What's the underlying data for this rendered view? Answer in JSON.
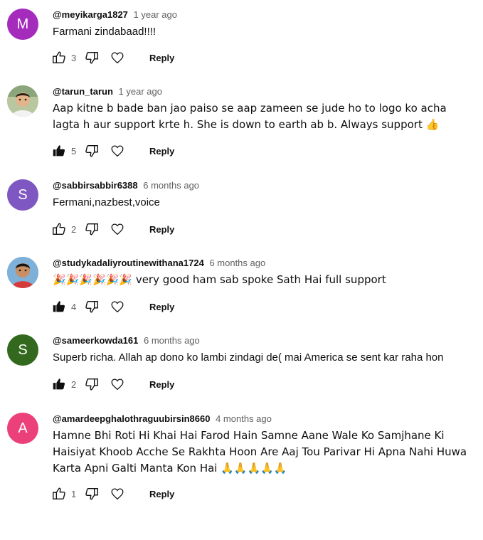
{
  "comments": [
    {
      "author": "@meyikarga1827",
      "time": "1 year ago",
      "text": "Farmani zindabaad!!!!",
      "likes": "3",
      "liked": false,
      "avatar": {
        "type": "letter",
        "letter": "M",
        "color": "#a52bbd"
      }
    },
    {
      "author": "@tarun_tarun",
      "time": "1 year ago",
      "text": "Aap kitne b bade ban jao paiso se aap zameen se jude ho to logo ko acha lagta h aur support krte h. She is down to earth ab b. Always support 👍",
      "likes": "5",
      "liked": true,
      "avatar": {
        "type": "photo"
      }
    },
    {
      "author": "@sabbirsabbir6388",
      "time": "6 months ago",
      "text": "Fermani,nazbest,voice",
      "likes": "2",
      "liked": false,
      "avatar": {
        "type": "letter",
        "letter": "S",
        "color": "#7e57c2"
      }
    },
    {
      "author": "@studykadaliyroutinewithana1724",
      "time": "6 months ago",
      "text": "🎉🎉🎉🎉🎉🎉 very good ham sab spoke Sath Hai full support",
      "likes": "4",
      "liked": true,
      "avatar": {
        "type": "photo"
      }
    },
    {
      "author": "@sameerkowda161",
      "time": "6 months ago",
      "text": "Superb richa. Allah ap dono ko lambi zindagi de( mai America se sent kar raha hon",
      "likes": "2",
      "liked": true,
      "avatar": {
        "type": "letter",
        "letter": "S",
        "color": "#33691e"
      }
    },
    {
      "author": "@amardeepghalothraguubirsin8660",
      "time": "4 months ago",
      "text": "Hamne Bhi Roti Hi Khai Hai Farod Hain Samne Aane Wale Ko Samjhane Ki Haisiyat Khoob Acche Se Rakhta Hoon Are Aaj Tou Parivar Hi Apna Nahi Huwa Karta Apni Galti Manta Kon Hai 🙏🙏🙏🙏🙏",
      "likes": "1",
      "liked": false,
      "avatar": {
        "type": "letter",
        "letter": "A",
        "color": "#ec407a"
      }
    }
  ],
  "labels": {
    "reply": "Reply"
  }
}
